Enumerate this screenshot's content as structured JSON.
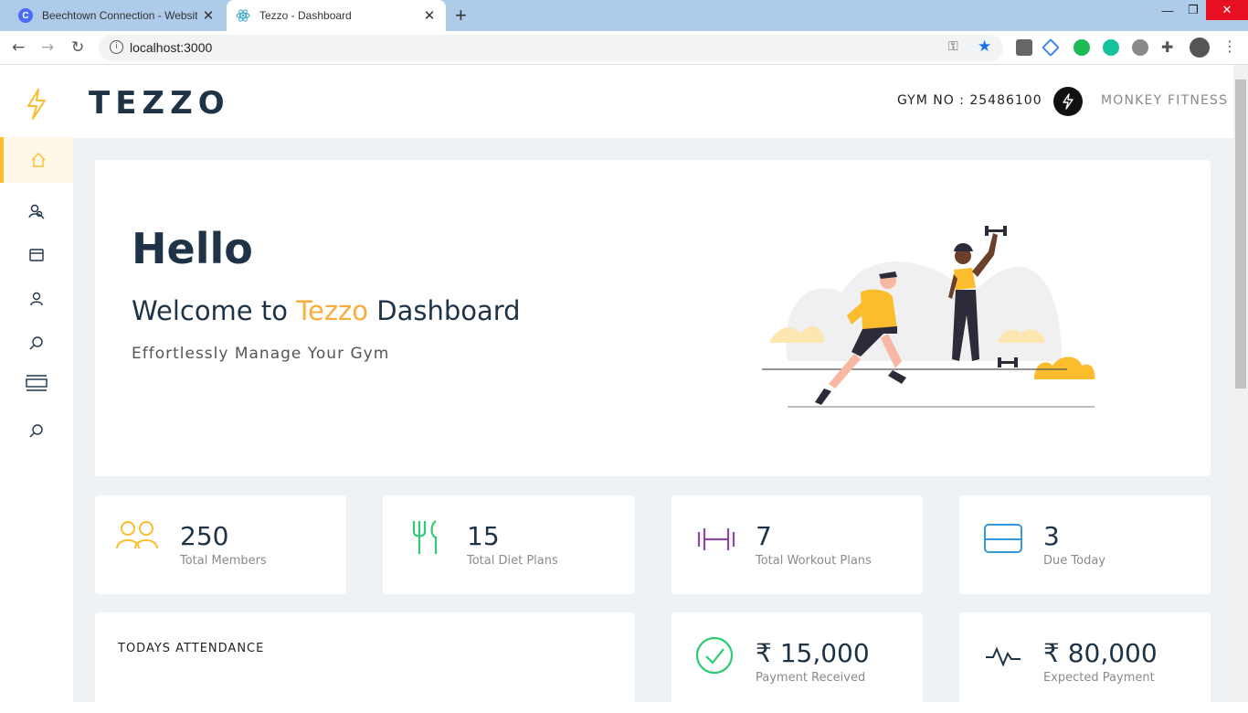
{
  "browser": {
    "tabs": [
      {
        "title": "Beechtown Connection - Website",
        "favicon_letter": "C",
        "active": false
      },
      {
        "title": "Tezzo - Dashboard",
        "active": true
      }
    ],
    "url": "localhost:3000"
  },
  "header": {
    "logo": "TEZZO",
    "gym_number": "GYM NO : 25486100",
    "brand_name": "MONKEY FITNESS"
  },
  "sidebar": {
    "items": [
      {
        "icon": "home-icon",
        "active": true
      },
      {
        "icon": "search-users-icon"
      },
      {
        "icon": "card-icon"
      },
      {
        "icon": "user-icon"
      },
      {
        "icon": "search-icon"
      },
      {
        "icon": "list-icon"
      },
      {
        "icon": "search-icon"
      }
    ]
  },
  "hero": {
    "greeting": "Hello",
    "welcome_prefix": "Welcome to ",
    "welcome_accent": "Tezzo",
    "welcome_suffix": " Dashboard",
    "subtitle": "Effortlessly Manage Your Gym"
  },
  "stats": [
    {
      "value": "250",
      "label": "Total Members",
      "icon": "members-icon",
      "color": "#fbbd2d"
    },
    {
      "value": "15",
      "label": "Total Diet Plans",
      "icon": "fork-icon",
      "color": "#2ecc71"
    },
    {
      "value": "7",
      "label": "Total Workout Plans",
      "icon": "dumbbell-icon",
      "color": "#8e44ad"
    },
    {
      "value": "3",
      "label": "Due Today",
      "icon": "card-icon",
      "color": "#3498db"
    }
  ],
  "attendance": {
    "title": "TODAYS ATTENDANCE"
  },
  "payments": [
    {
      "value": "₹ 15,000",
      "label": "Payment Received",
      "icon": "check-circle-icon",
      "color": "#2ecc71"
    },
    {
      "value": "₹ 80,000",
      "label": "Expected Payment",
      "icon": "activity-icon",
      "color": "#1e3347"
    }
  ]
}
